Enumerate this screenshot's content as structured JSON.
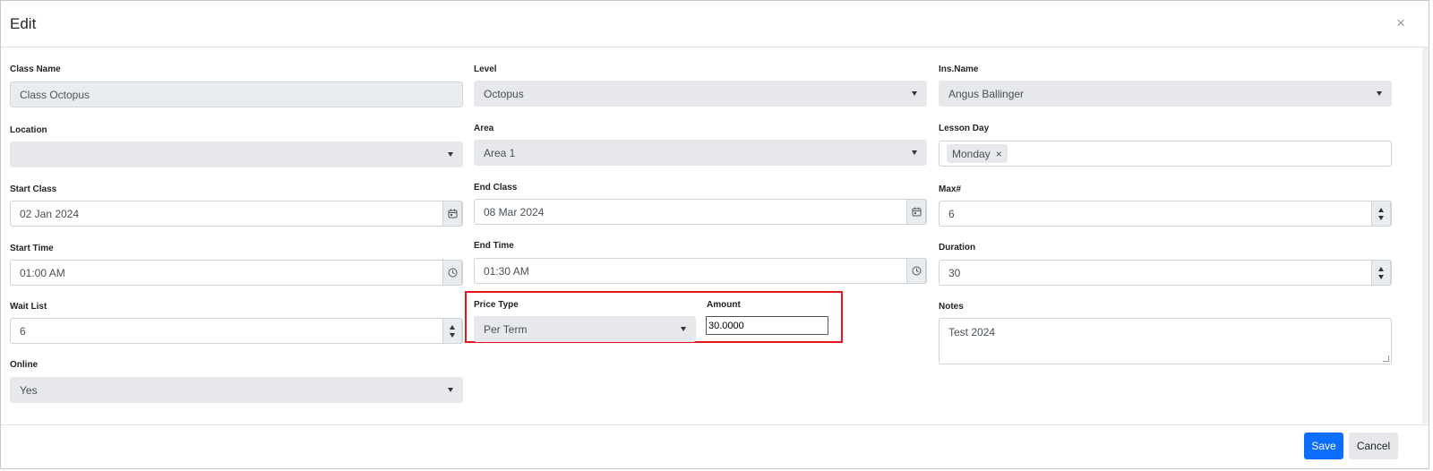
{
  "modal": {
    "title": "Edit",
    "close_label": "×"
  },
  "fields": {
    "class_name": {
      "label": "Class Name",
      "value": "Class Octopus"
    },
    "level": {
      "label": "Level",
      "value": "Octopus"
    },
    "ins_name": {
      "label": "Ins.Name",
      "value": "Angus Ballinger"
    },
    "location": {
      "label": "Location",
      "value": ""
    },
    "area": {
      "label": "Area",
      "value": "Area 1"
    },
    "lesson_day": {
      "label": "Lesson Day",
      "tags": [
        "Monday"
      ],
      "remove_label": "×"
    },
    "start_class": {
      "label": "Start Class",
      "value": "02 Jan 2024"
    },
    "end_class": {
      "label": "End Class",
      "value": "08 Mar 2024"
    },
    "max": {
      "label": "Max#",
      "value": "6"
    },
    "start_time": {
      "label": "Start Time",
      "value": "01:00 AM"
    },
    "end_time": {
      "label": "End Time",
      "value": "01:30 AM"
    },
    "duration": {
      "label": "Duration",
      "value": "30"
    },
    "wait_list": {
      "label": "Wait List",
      "value": "6"
    },
    "price_type": {
      "label": "Price Type",
      "value": "Per Term"
    },
    "amount": {
      "label": "Amount",
      "value": "30.0000"
    },
    "notes": {
      "label": "Notes",
      "value": "Test 2024"
    },
    "online": {
      "label": "Online",
      "value": "Yes"
    }
  },
  "footer": {
    "save_label": "Save",
    "cancel_label": "Cancel"
  },
  "colors": {
    "highlight": "#e8131b",
    "primary": "#0d6efd"
  },
  "icons": {
    "calendar": "calendar-icon",
    "clock": "clock-icon",
    "close": "close-icon"
  }
}
